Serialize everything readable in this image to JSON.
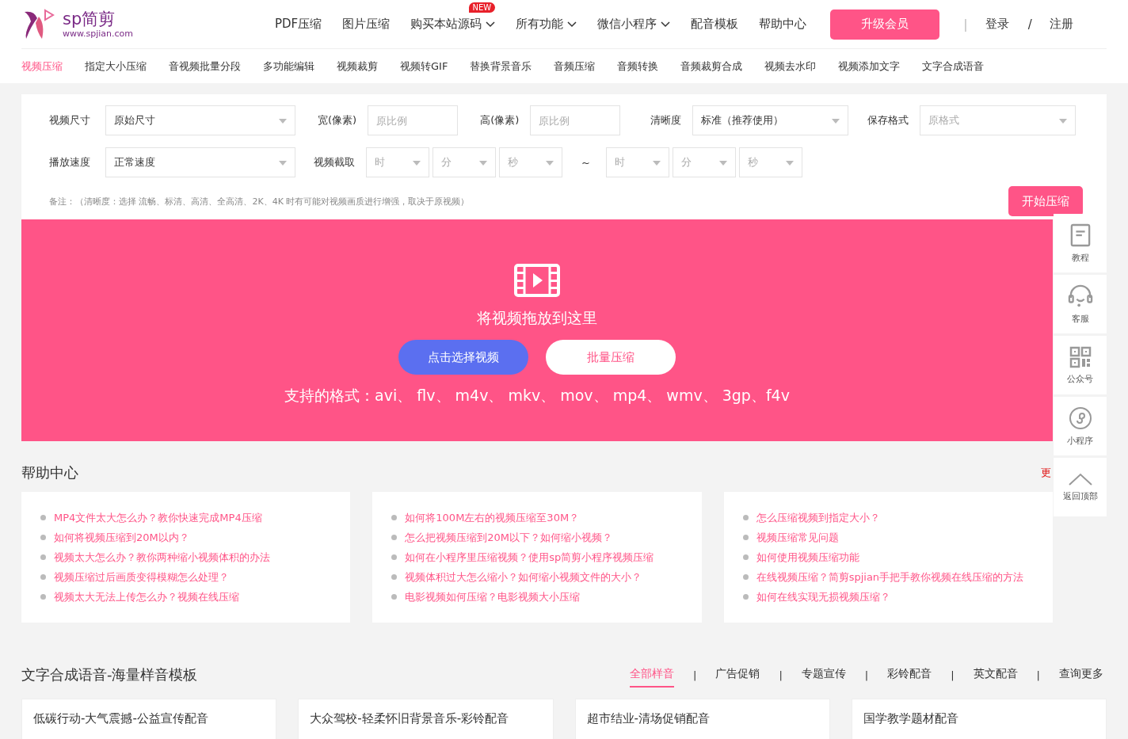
{
  "logo": {
    "name": "sp简剪",
    "url": "www.spjian.com"
  },
  "nav": [
    {
      "label": "PDF压缩",
      "dropdown": false
    },
    {
      "label": "图片压缩",
      "dropdown": false
    },
    {
      "label": "购买本站源码",
      "dropdown": true,
      "badge": "NEW"
    },
    {
      "label": "所有功能",
      "dropdown": true
    },
    {
      "label": "微信小程序",
      "dropdown": true
    },
    {
      "label": "配音模板",
      "dropdown": false
    },
    {
      "label": "帮助中心",
      "dropdown": false
    }
  ],
  "upgrade_button": "升级会员",
  "auth": {
    "separator_1": "|",
    "login": "登录",
    "separator_2": "/",
    "register": "注册"
  },
  "sub_nav": [
    {
      "label": "视频压缩",
      "selected": true
    },
    {
      "label": "指定大小压缩",
      "selected": false
    },
    {
      "label": "音视频批量分段",
      "selected": false
    },
    {
      "label": "多功能编辑",
      "selected": false
    },
    {
      "label": "视频裁剪",
      "selected": false
    },
    {
      "label": "视频转GIF",
      "selected": false
    },
    {
      "label": "替换背景音乐",
      "selected": false
    },
    {
      "label": "音频压缩",
      "selected": false
    },
    {
      "label": "音频转换",
      "selected": false
    },
    {
      "label": "音频裁剪合成",
      "selected": false
    },
    {
      "label": "视频去水印",
      "selected": false
    },
    {
      "label": "视频添加文字",
      "selected": false
    },
    {
      "label": "文字合成语音",
      "selected": false
    }
  ],
  "settings": {
    "row_1": [
      {
        "label": "视频尺寸",
        "kind": "select",
        "value": "原始尺寸"
      },
      {
        "label": "宽(像素)",
        "kind": "input",
        "placeholder": "原比例"
      },
      {
        "label": "高(像素)",
        "kind": "input",
        "placeholder": "原比例"
      },
      {
        "label": "清晰度",
        "kind": "select",
        "value": "标准（推荐使用）"
      },
      {
        "label": "保存格式",
        "kind": "select",
        "placeholder": "原格式"
      }
    ],
    "speed": {
      "label": "播放速度",
      "value": "正常速度"
    },
    "trim": {
      "label": "视频截取",
      "start": [
        "时",
        "分",
        "秒"
      ],
      "separator": "~",
      "end": [
        "时",
        "分",
        "秒"
      ]
    },
    "note": "备注：（清晰度：选择 流畅、标清、高清、全高清、2K、4K 时有可能对视频画质进行增强，取决于原视频）",
    "start_button": "开始压缩"
  },
  "drop_zone": {
    "title": "将视频拖放到这里",
    "select_button": "点击选择视频",
    "batch_button": "批量压缩",
    "formats": "支持的格式：avi、 flv、 m4v、 mkv、 mov、 mp4、 wmv、 3gp、f4v"
  },
  "side_tools": [
    {
      "kind": "book",
      "label": "教程"
    },
    {
      "kind": "headset",
      "label": "客服"
    },
    {
      "kind": "qr",
      "label": "公众号"
    },
    {
      "kind": "mini",
      "label": "小程序"
    },
    {
      "kind": "top",
      "label": "返回顶部"
    }
  ],
  "help": {
    "title": "帮助中心",
    "more": "更",
    "columns": [
      [
        "MP4文件太大怎么办？教你快速完成MP4压缩",
        "如何将视频压缩到20M以内？",
        "视频太大怎么办？教你两种缩小视频体积的办法",
        "视频压缩过后画质变得模糊怎么处理？",
        "视频太大无法上传怎么办？视频在线压缩"
      ],
      [
        "如何将100M左右的视频压缩至30M？",
        "怎么把视频压缩到20M以下？如何缩小视频？",
        "如何在小程序里压缩视频？使用sp简剪小程序视频压缩",
        "视频体积过大怎么缩小？如何缩小视频文件的大小？",
        "电影视频如何压缩？电影视频大小压缩"
      ],
      [
        "怎么压缩视频到指定大小？",
        "视频压缩常见问题",
        "如何使用视频压缩功能",
        "在线视频压缩？简剪spjian手把手教你视频在线压缩的方法",
        "如何在线实现无损视频压缩？"
      ]
    ]
  },
  "templates": {
    "title": "文字合成语音-海量样音模板",
    "tabs": [
      {
        "label": "全部样音",
        "selected": true
      },
      {
        "label": "广告促销",
        "selected": false
      },
      {
        "label": "专题宣传",
        "selected": false
      },
      {
        "label": "彩铃配音",
        "selected": false
      },
      {
        "label": "英文配音",
        "selected": false
      }
    ],
    "more": "查询更多",
    "tab_separator": "|",
    "cards": [
      "低碳行动-大气震撼-公益宣传配音",
      "大众驾校-轻柔怀旧背景音乐-彩铃配音",
      "超市结业-清场促销配音",
      "国学教学题材配音"
    ]
  }
}
